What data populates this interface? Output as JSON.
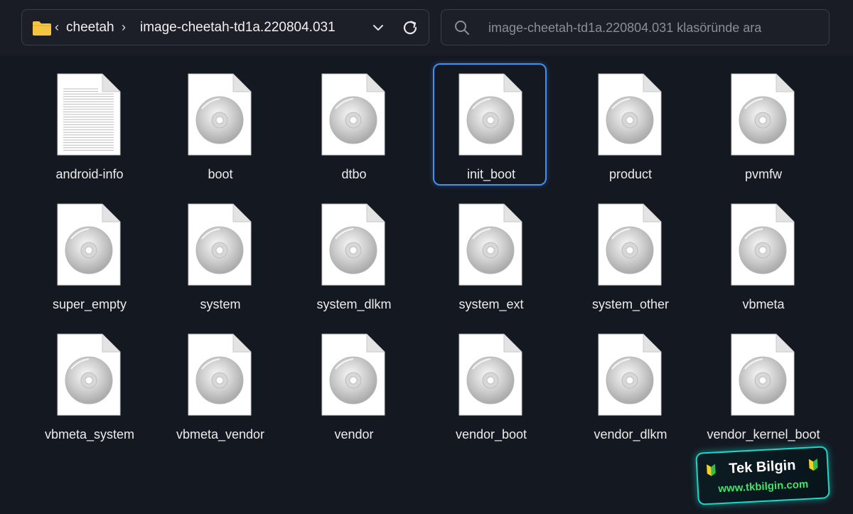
{
  "breadcrumb": {
    "items": [
      "cheetah",
      "image-cheetah-td1a.220804.031"
    ]
  },
  "search": {
    "placeholder": "image-cheetah-td1a.220804.031 klasöründe ara"
  },
  "files": [
    {
      "name": "android-info",
      "type": "text",
      "selected": false
    },
    {
      "name": "boot",
      "type": "image",
      "selected": false
    },
    {
      "name": "dtbo",
      "type": "image",
      "selected": false
    },
    {
      "name": "init_boot",
      "type": "image",
      "selected": true
    },
    {
      "name": "product",
      "type": "image",
      "selected": false
    },
    {
      "name": "pvmfw",
      "type": "image",
      "selected": false
    },
    {
      "name": "super_empty",
      "type": "image",
      "selected": false
    },
    {
      "name": "system",
      "type": "image",
      "selected": false
    },
    {
      "name": "system_dlkm",
      "type": "image",
      "selected": false
    },
    {
      "name": "system_ext",
      "type": "image",
      "selected": false
    },
    {
      "name": "system_other",
      "type": "image",
      "selected": false
    },
    {
      "name": "vbmeta",
      "type": "image",
      "selected": false
    },
    {
      "name": "vbmeta_system",
      "type": "image",
      "selected": false
    },
    {
      "name": "vbmeta_vendor",
      "type": "image",
      "selected": false
    },
    {
      "name": "vendor",
      "type": "image",
      "selected": false
    },
    {
      "name": "vendor_boot",
      "type": "image",
      "selected": false
    },
    {
      "name": "vendor_dlkm",
      "type": "image",
      "selected": false
    },
    {
      "name": "vendor_kernel_boot",
      "type": "image",
      "selected": false
    }
  ],
  "watermark": {
    "title": "Tek Bilgin",
    "url": "www.tkbilgin.com"
  },
  "colors": {
    "accent": "#3f92f2",
    "folder": "#f5c542",
    "watermark_border": "#19d9c9",
    "watermark_url": "#43e36a"
  }
}
